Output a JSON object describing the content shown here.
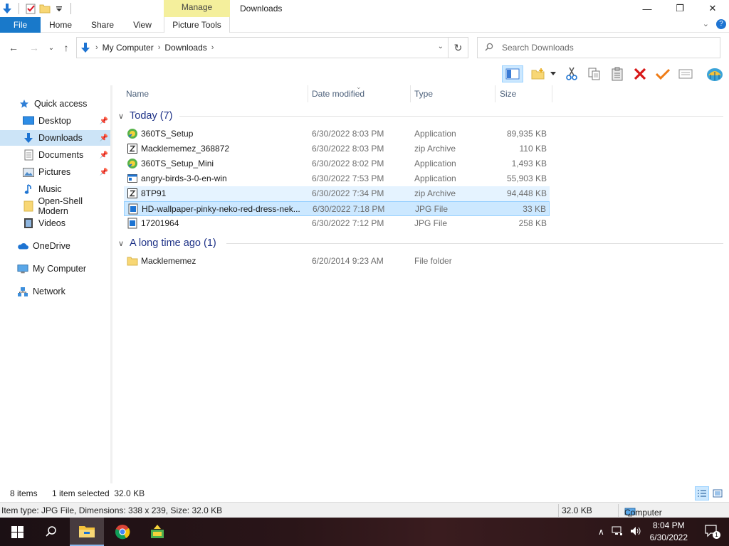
{
  "window": {
    "title": "Downloads",
    "contextual_tab_header": "Manage",
    "minimize_glyph": "—",
    "maximize_glyph": "❐",
    "close_glyph": "✕"
  },
  "ribbon": {
    "tabs": [
      "File",
      "Home",
      "Share",
      "View",
      "Picture Tools"
    ],
    "collapse_glyph": "⌄",
    "help_glyph": "?"
  },
  "address": {
    "crumbs": [
      "My Computer",
      "Downloads"
    ],
    "search_placeholder": "Search Downloads"
  },
  "sidebar": {
    "items": [
      {
        "label": "Quick access",
        "icon": "star-icon",
        "pinned": false
      },
      {
        "label": "Desktop",
        "icon": "desktop-icon",
        "pinned": true
      },
      {
        "label": "Downloads",
        "icon": "download-arrow-icon",
        "pinned": true,
        "selected": true
      },
      {
        "label": "Documents",
        "icon": "documents-icon",
        "pinned": true
      },
      {
        "label": "Pictures",
        "icon": "pictures-icon",
        "pinned": true
      },
      {
        "label": "Music",
        "icon": "music-icon",
        "pinned": false
      },
      {
        "label": "Open-Shell Modern",
        "icon": "folder-icon",
        "pinned": false
      },
      {
        "label": "Videos",
        "icon": "videos-icon",
        "pinned": false
      },
      {
        "label": "OneDrive",
        "icon": "cloud-icon",
        "pinned": false
      },
      {
        "label": "My Computer",
        "icon": "computer-icon",
        "pinned": false
      },
      {
        "label": "Network",
        "icon": "network-icon",
        "pinned": false
      }
    ]
  },
  "columns": {
    "name": "Name",
    "date": "Date modified",
    "type": "Type",
    "size": "Size"
  },
  "groups": [
    {
      "title": "Today (7)",
      "files": [
        {
          "name": "360TS_Setup",
          "date": "6/30/2022 8:03 PM",
          "type": "Application",
          "size": "89,935 KB",
          "icon": "installer-icon"
        },
        {
          "name": "Macklememez_368872",
          "date": "6/30/2022 8:03 PM",
          "type": "zip Archive",
          "size": "110 KB",
          "icon": "zip-icon"
        },
        {
          "name": "360TS_Setup_Mini",
          "date": "6/30/2022 8:02 PM",
          "type": "Application",
          "size": "1,493 KB",
          "icon": "installer-icon"
        },
        {
          "name": "angry-birds-3-0-en-win",
          "date": "6/30/2022 7:53 PM",
          "type": "Application",
          "size": "55,903 KB",
          "icon": "app-window-icon"
        },
        {
          "name": "8TP91",
          "date": "6/30/2022 7:34 PM",
          "type": "zip Archive",
          "size": "94,448 KB",
          "icon": "zip-icon"
        },
        {
          "name": "HD-wallpaper-pinky-neko-red-dress-nek...",
          "date": "6/30/2022 7:18 PM",
          "type": "JPG File",
          "size": "33 KB",
          "icon": "image-file-icon"
        },
        {
          "name": "17201964",
          "date": "6/30/2022 7:12 PM",
          "type": "JPG File",
          "size": "258 KB",
          "icon": "image-file-icon"
        }
      ]
    },
    {
      "title": "A long time ago (1)",
      "files": [
        {
          "name": "Macklememez",
          "date": "6/20/2014 9:23 AM",
          "type": "File folder",
          "size": "",
          "icon": "folder-icon"
        }
      ]
    }
  ],
  "status": {
    "item_count": "8 items",
    "selection": "1 item selected  32.0 KB"
  },
  "infobar": {
    "details": "Item type: JPG File, Dimensions: 338 x 239, Size: 32.0 KB",
    "size": "32.0 KB",
    "location": "Computer"
  },
  "taskbar": {
    "time": "8:04 PM",
    "date": "6/30/2022",
    "notification_count": "1"
  },
  "colors": {
    "accent": "#1979ca",
    "selection": "#cce8ff",
    "group_title": "#1e3287",
    "manage_tab": "#f4ef9c"
  }
}
